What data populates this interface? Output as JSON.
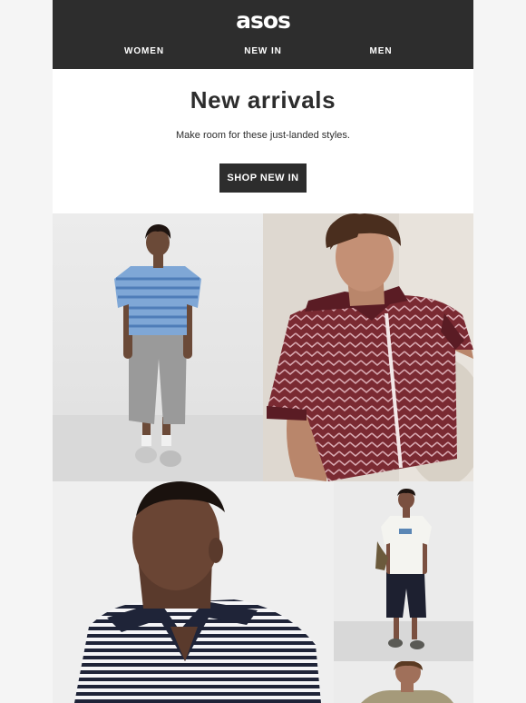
{
  "brand": {
    "logo": "asos"
  },
  "nav": {
    "women": "WOMEN",
    "new_in": "NEW IN",
    "men": "MEN"
  },
  "hero": {
    "title": "New arrivals",
    "subtitle": "Make room for these just-landed styles.",
    "cta": "SHOP NEW IN"
  },
  "colors": {
    "header_bg": "#2d2d2d",
    "page_bg": "#f5f5f5",
    "cta_bg": "#2d2d2d",
    "text": "#2d2d2d"
  },
  "products": [
    {
      "icon": "model-blue-striped-tee-grey-shorts-photo"
    },
    {
      "icon": "model-burgundy-knit-polo-photo"
    },
    {
      "icon": "model-navy-striped-polo-photo"
    },
    {
      "icon": "model-white-tee-black-jorts-photo"
    },
    {
      "icon": "model-olive-top-photo"
    }
  ]
}
